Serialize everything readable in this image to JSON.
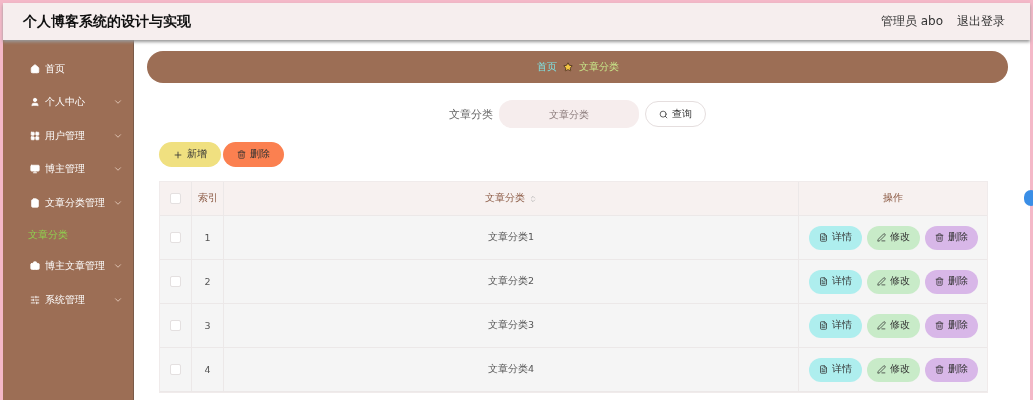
{
  "header": {
    "title": "个人博客系统的设计与实现",
    "user": "管理员 abo",
    "logout": "退出登录"
  },
  "sidebar": {
    "items": [
      {
        "label": "首页",
        "has_submenu": false
      },
      {
        "label": "个人中心",
        "has_submenu": true
      },
      {
        "label": "用户管理",
        "has_submenu": true
      },
      {
        "label": "博主管理",
        "has_submenu": true
      },
      {
        "label": "文章分类管理",
        "has_submenu": true,
        "children": [
          {
            "label": "文章分类",
            "selected": true
          }
        ]
      },
      {
        "label": "博主文章管理",
        "has_submenu": true
      },
      {
        "label": "系统管理",
        "has_submenu": true
      }
    ]
  },
  "breadcrumb": {
    "home": "首页",
    "current": "文章分类"
  },
  "search": {
    "label": "文章分类",
    "placeholder": "文章分类",
    "button": "查询"
  },
  "actions": {
    "add": "新增",
    "delete": "删除"
  },
  "table": {
    "columns": [
      "索引",
      "文章分类",
      "操作"
    ],
    "select_all_checked": false,
    "rows": [
      {
        "index": "1",
        "category": "文章分类1",
        "checked": false,
        "buttons": [
          "详情",
          "修改",
          "删除"
        ]
      },
      {
        "index": "2",
        "category": "文章分类2",
        "checked": false,
        "buttons": [
          "详情",
          "修改",
          "删除"
        ]
      },
      {
        "index": "3",
        "category": "文章分类3",
        "checked": false,
        "buttons": [
          "详情",
          "修改",
          "删除"
        ]
      },
      {
        "index": "4",
        "category": "文章分类4",
        "checked": false,
        "buttons": [
          "详情",
          "修改",
          "删除"
        ]
      }
    ]
  }
}
